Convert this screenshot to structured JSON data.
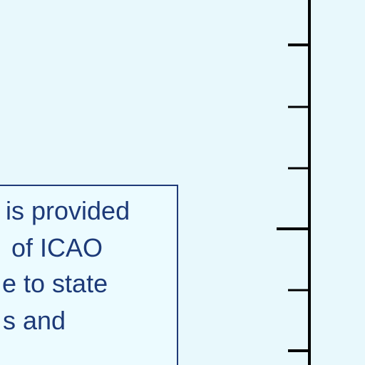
{
  "note": {
    "lines": [
      "is provided",
      "of ICAO",
      "e to state",
      "s and"
    ]
  },
  "colors": {
    "background": "#e8f8fc",
    "text": "#1d3a78",
    "axis": "#000000"
  }
}
